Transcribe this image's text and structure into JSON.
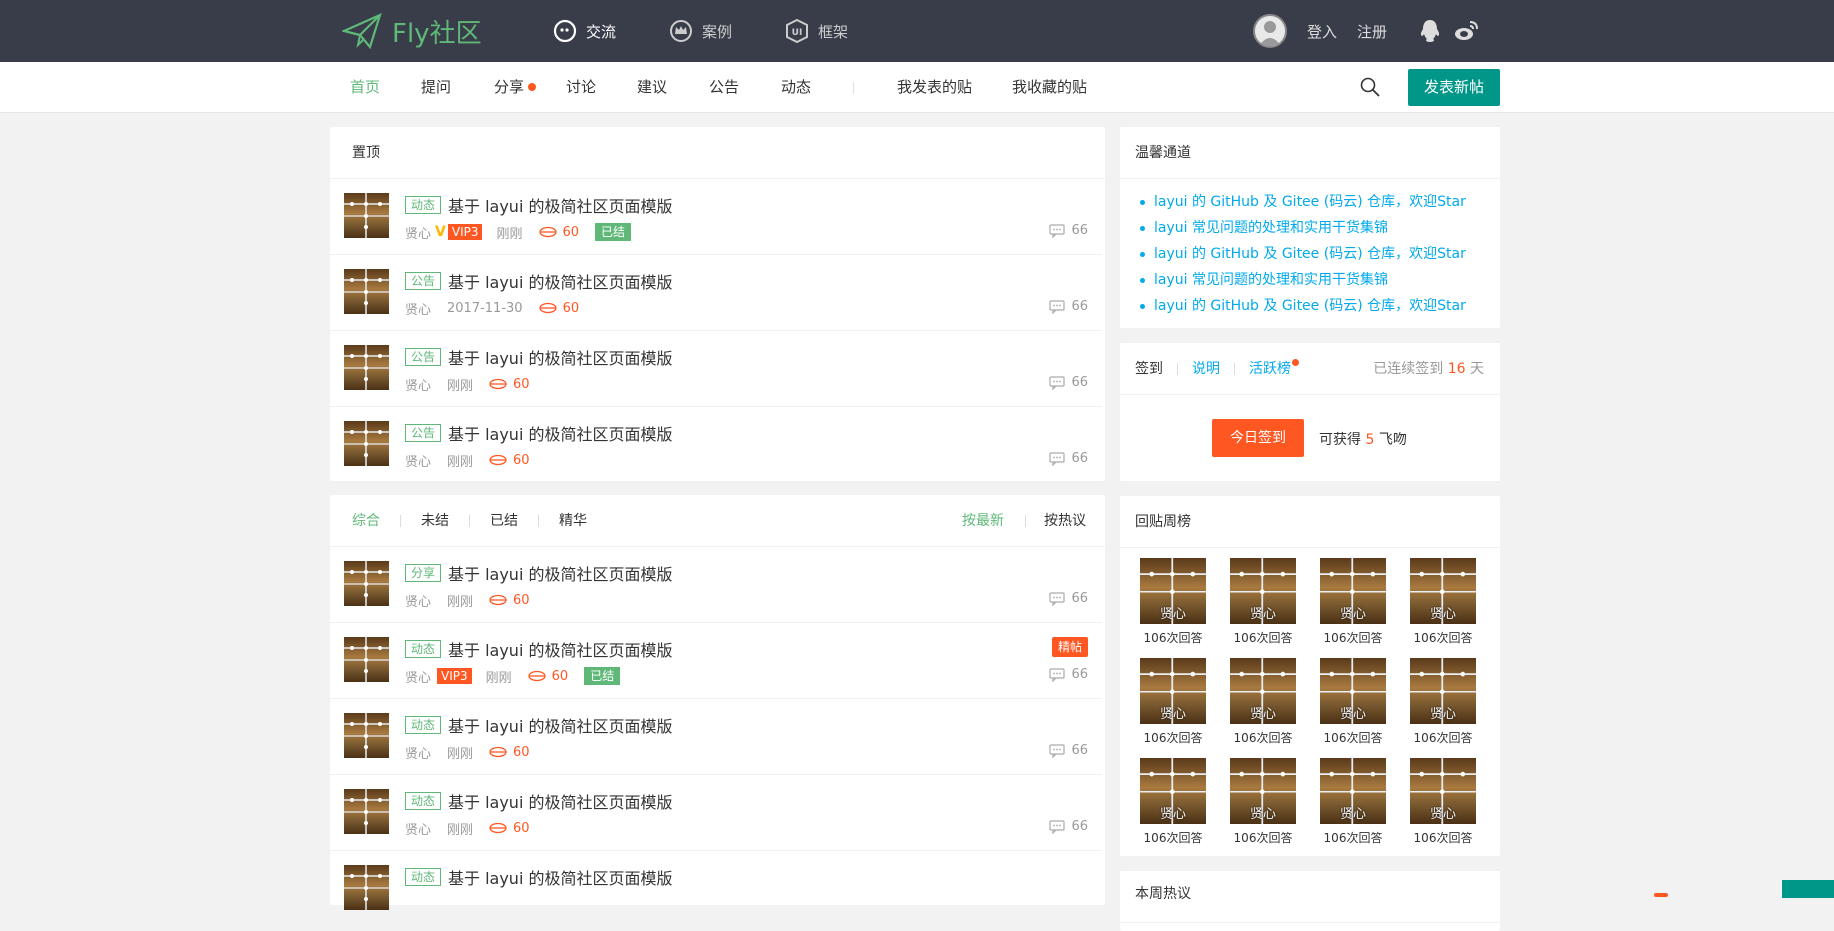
{
  "header": {
    "logo_text": "Fly社区",
    "nav": [
      {
        "label": "交流",
        "icon": "chat-icon",
        "active": true
      },
      {
        "label": "案例",
        "icon": "crown-icon",
        "active": false
      },
      {
        "label": "框架",
        "icon": "ui-icon",
        "active": false
      }
    ],
    "login": "登入",
    "register": "注册",
    "icons": [
      "qq-icon",
      "weibo-icon"
    ]
  },
  "subnav": {
    "items": [
      "首页",
      "提问",
      "分享",
      "讨论",
      "建议",
      "公告",
      "动态"
    ],
    "active": "首页",
    "my_posts": "我发表的贴",
    "my_favorites": "我收藏的贴",
    "new_post": "发表新帖"
  },
  "pinned": {
    "title": "置顶",
    "rows": [
      {
        "tag": "动态",
        "title": "基于 layui 的极简社区页面模版",
        "author": "贤心",
        "verified": "V",
        "vip": "VIP3",
        "time": "刚刚",
        "views": "60",
        "status": "已结",
        "comments": "66"
      },
      {
        "tag": "公告",
        "title": "基于 layui 的极简社区页面模版",
        "author": "贤心",
        "time": "2017-11-30",
        "views": "60",
        "comments": "66"
      },
      {
        "tag": "公告",
        "title": "基于 layui 的极简社区页面模版",
        "author": "贤心",
        "time": "刚刚",
        "views": "60",
        "comments": "66"
      },
      {
        "tag": "公告",
        "title": "基于 layui 的极简社区页面模版",
        "author": "贤心",
        "time": "刚刚",
        "views": "60",
        "comments": "66"
      }
    ]
  },
  "list": {
    "filters": [
      "综合",
      "未结",
      "已结",
      "精华"
    ],
    "sort": [
      "按最新",
      "按热议"
    ],
    "rows": [
      {
        "tag": "分享",
        "title": "基于 layui 的极简社区页面模版",
        "author": "贤心",
        "time": "刚刚",
        "views": "60",
        "comments": "66"
      },
      {
        "tag": "动态",
        "title": "基于 layui 的极简社区页面模版",
        "author": "贤心",
        "vip": "VIP3",
        "time": "刚刚",
        "views": "60",
        "status": "已结",
        "badge": "精帖",
        "comments": "66"
      },
      {
        "tag": "动态",
        "title": "基于 layui 的极简社区页面模版",
        "author": "贤心",
        "time": "刚刚",
        "views": "60",
        "comments": "66"
      },
      {
        "tag": "动态",
        "title": "基于 layui 的极简社区页面模版",
        "author": "贤心",
        "time": "刚刚",
        "views": "60",
        "comments": "66"
      },
      {
        "tag": "动态",
        "title": "基于 layui 的极简社区页面模版"
      }
    ]
  },
  "warm": {
    "title": "温馨通道",
    "links": [
      "layui 的 GitHub 及 Gitee (码云) 仓库，欢迎Star",
      "layui 常见问题的处理和实用干货集锦",
      "layui 的 GitHub 及 Gitee (码云) 仓库，欢迎Star",
      "layui 常见问题的处理和实用干货集锦",
      "layui 的 GitHub 及 Gitee (码云) 仓库，欢迎Star"
    ]
  },
  "sign": {
    "tab_sign": "签到",
    "tab_desc": "说明",
    "tab_rank": "活跃榜",
    "streak_prefix": "已连续签到",
    "streak_days": "16",
    "streak_suffix": "天",
    "button": "今日签到",
    "gain_prefix": "可获得",
    "gain_num": "5",
    "gain_suffix": "飞吻"
  },
  "ranking": {
    "title": "回贴周榜",
    "name": "贤心",
    "count": "106次回答"
  },
  "hot": {
    "title": "本周热议"
  },
  "colors": {
    "topbar": "#393d49",
    "green": "#5fb878",
    "teal": "#009688",
    "orange": "#ff5722",
    "blue": "#01aaed"
  }
}
